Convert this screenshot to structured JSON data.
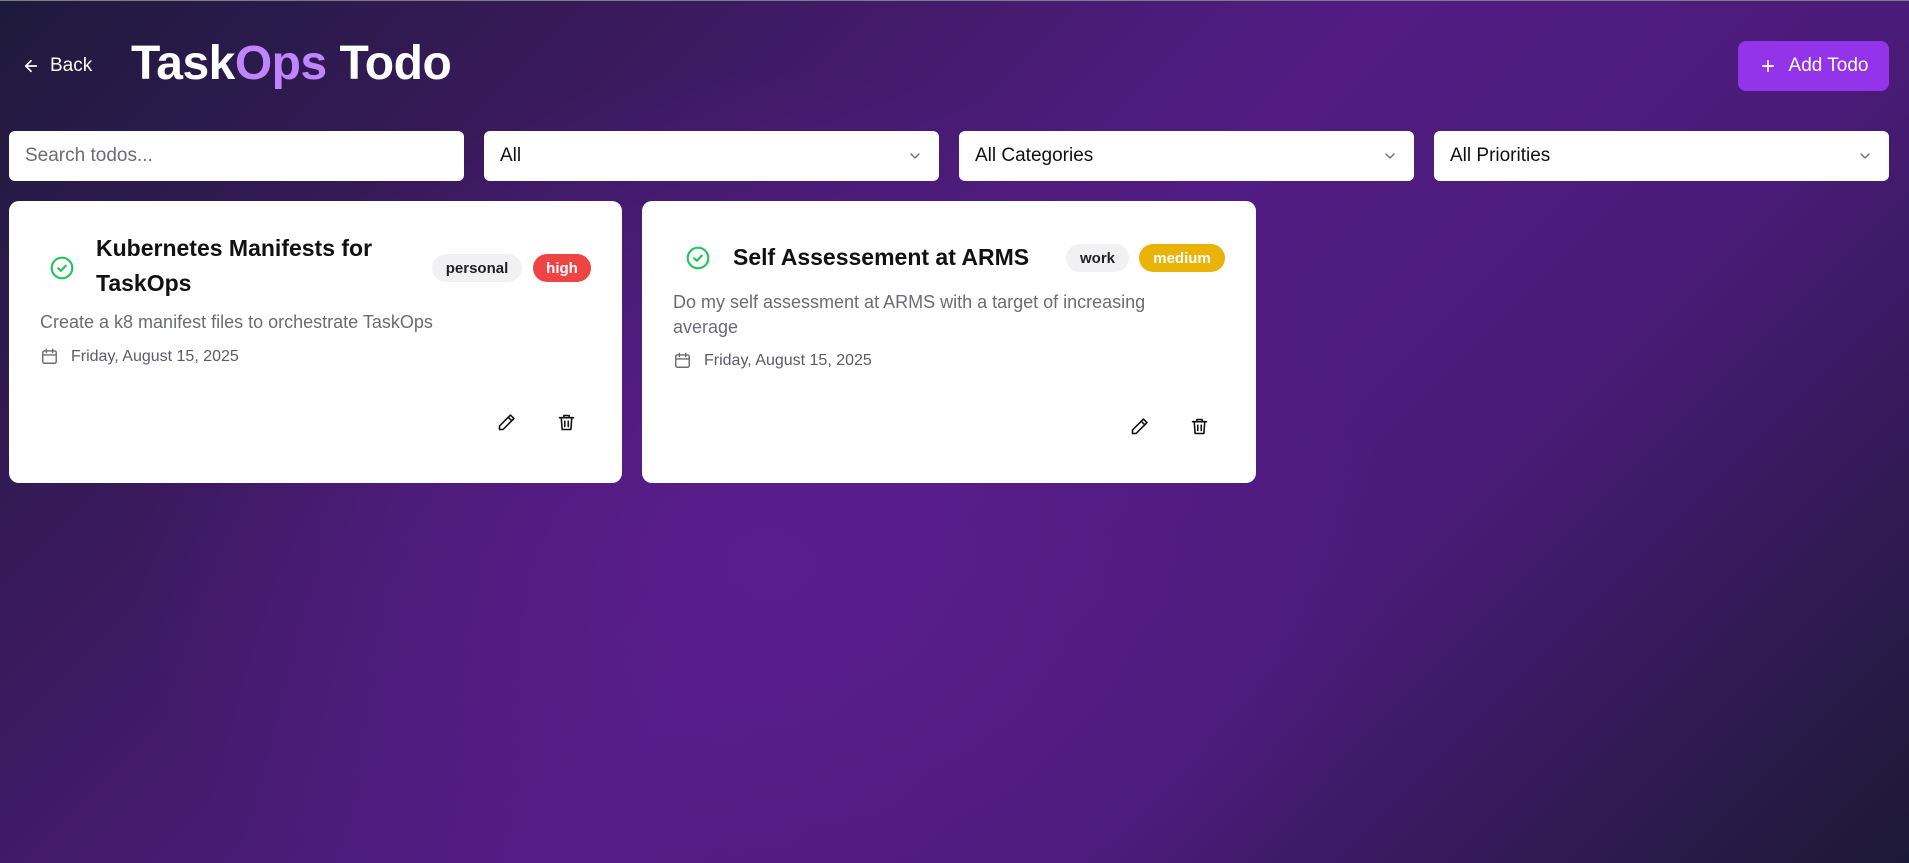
{
  "header": {
    "back_label": "Back",
    "title_part1": "Task",
    "title_accent": "Ops",
    "title_part2": " Todo",
    "add_label": "Add Todo"
  },
  "filters": {
    "search_placeholder": "Search todos...",
    "status_selected": "All",
    "category_selected": "All Categories",
    "priority_selected": "All Priorities"
  },
  "todos": [
    {
      "title": "Kubernetes Manifests for TaskOps",
      "category": "personal",
      "priority": "high",
      "description": "Create a k8 manifest files to orchestrate TaskOps",
      "date": "Friday, August 15, 2025"
    },
    {
      "title": "Self Assessement at ARMS",
      "category": "work",
      "priority": "medium",
      "description": "Do my self assessment at ARMS with a target of increasing average",
      "date": "Friday, August 15, 2025"
    }
  ],
  "colors": {
    "accent": "#c084fc",
    "primary_button": "#9333ea",
    "priority_high": "#ef4444",
    "priority_medium": "#eab308",
    "check_green": "#22c55e"
  },
  "icons": {
    "back": "arrow-left-icon",
    "add": "plus-icon",
    "dropdown": "chevron-down-icon",
    "complete": "check-circle-icon",
    "date": "calendar-icon",
    "edit": "pencil-icon",
    "delete": "trash-icon"
  }
}
